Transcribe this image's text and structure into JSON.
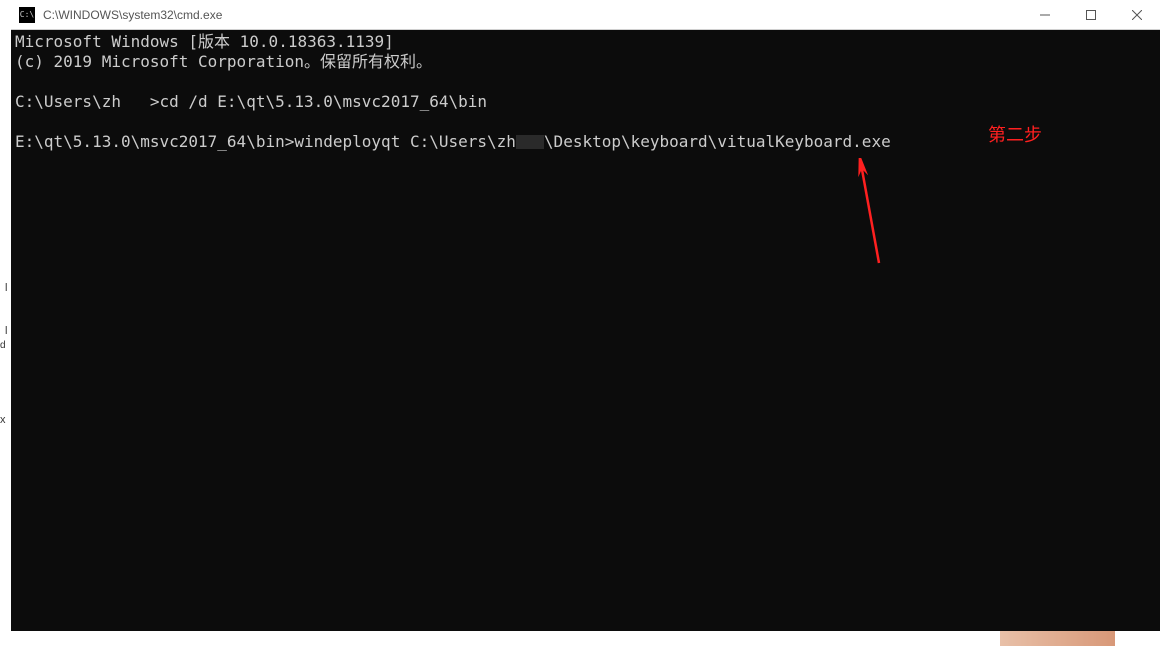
{
  "window": {
    "title": "C:\\WINDOWS\\system32\\cmd.exe"
  },
  "terminal": {
    "line1": "Microsoft Windows [版本 10.0.18363.1139]",
    "line2": "(c) 2019 Microsoft Corporation。保留所有权利。",
    "line3_prompt": "C:\\Users\\zh   >",
    "line3_cmd": "cd /d E:\\qt\\5.13.0\\msvc2017_64\\bin",
    "line4_prompt": "E:\\qt\\5.13.0\\msvc2017_64\\bin>",
    "line4_cmd_a": "windeployqt C:\\Users\\zh",
    "line4_cmd_b": "\\Desktop\\keyboard\\vitualKeyboard.exe"
  },
  "annotation": {
    "label": "第二步"
  },
  "colors": {
    "annotation_red": "#ff2020",
    "terminal_bg": "#0c0c0c",
    "terminal_fg": "#cccccc"
  }
}
